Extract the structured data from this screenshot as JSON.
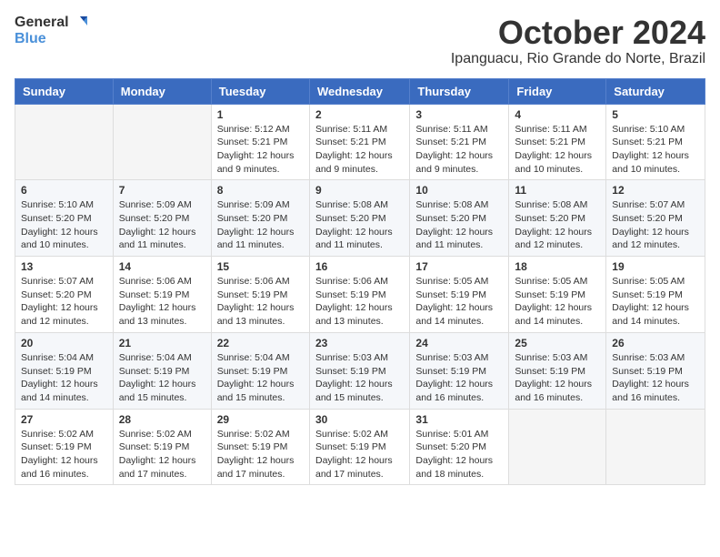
{
  "header": {
    "logo_general": "General",
    "logo_blue": "Blue",
    "month_title": "October 2024",
    "location": "Ipanguacu, Rio Grande do Norte, Brazil"
  },
  "columns": [
    "Sunday",
    "Monday",
    "Tuesday",
    "Wednesday",
    "Thursday",
    "Friday",
    "Saturday"
  ],
  "weeks": [
    [
      {
        "day": "",
        "sunrise": "",
        "sunset": "",
        "daylight": ""
      },
      {
        "day": "",
        "sunrise": "",
        "sunset": "",
        "daylight": ""
      },
      {
        "day": "1",
        "sunrise": "Sunrise: 5:12 AM",
        "sunset": "Sunset: 5:21 PM",
        "daylight": "Daylight: 12 hours and 9 minutes."
      },
      {
        "day": "2",
        "sunrise": "Sunrise: 5:11 AM",
        "sunset": "Sunset: 5:21 PM",
        "daylight": "Daylight: 12 hours and 9 minutes."
      },
      {
        "day": "3",
        "sunrise": "Sunrise: 5:11 AM",
        "sunset": "Sunset: 5:21 PM",
        "daylight": "Daylight: 12 hours and 9 minutes."
      },
      {
        "day": "4",
        "sunrise": "Sunrise: 5:11 AM",
        "sunset": "Sunset: 5:21 PM",
        "daylight": "Daylight: 12 hours and 10 minutes."
      },
      {
        "day": "5",
        "sunrise": "Sunrise: 5:10 AM",
        "sunset": "Sunset: 5:21 PM",
        "daylight": "Daylight: 12 hours and 10 minutes."
      }
    ],
    [
      {
        "day": "6",
        "sunrise": "Sunrise: 5:10 AM",
        "sunset": "Sunset: 5:20 PM",
        "daylight": "Daylight: 12 hours and 10 minutes."
      },
      {
        "day": "7",
        "sunrise": "Sunrise: 5:09 AM",
        "sunset": "Sunset: 5:20 PM",
        "daylight": "Daylight: 12 hours and 11 minutes."
      },
      {
        "day": "8",
        "sunrise": "Sunrise: 5:09 AM",
        "sunset": "Sunset: 5:20 PM",
        "daylight": "Daylight: 12 hours and 11 minutes."
      },
      {
        "day": "9",
        "sunrise": "Sunrise: 5:08 AM",
        "sunset": "Sunset: 5:20 PM",
        "daylight": "Daylight: 12 hours and 11 minutes."
      },
      {
        "day": "10",
        "sunrise": "Sunrise: 5:08 AM",
        "sunset": "Sunset: 5:20 PM",
        "daylight": "Daylight: 12 hours and 11 minutes."
      },
      {
        "day": "11",
        "sunrise": "Sunrise: 5:08 AM",
        "sunset": "Sunset: 5:20 PM",
        "daylight": "Daylight: 12 hours and 12 minutes."
      },
      {
        "day": "12",
        "sunrise": "Sunrise: 5:07 AM",
        "sunset": "Sunset: 5:20 PM",
        "daylight": "Daylight: 12 hours and 12 minutes."
      }
    ],
    [
      {
        "day": "13",
        "sunrise": "Sunrise: 5:07 AM",
        "sunset": "Sunset: 5:20 PM",
        "daylight": "Daylight: 12 hours and 12 minutes."
      },
      {
        "day": "14",
        "sunrise": "Sunrise: 5:06 AM",
        "sunset": "Sunset: 5:19 PM",
        "daylight": "Daylight: 12 hours and 13 minutes."
      },
      {
        "day": "15",
        "sunrise": "Sunrise: 5:06 AM",
        "sunset": "Sunset: 5:19 PM",
        "daylight": "Daylight: 12 hours and 13 minutes."
      },
      {
        "day": "16",
        "sunrise": "Sunrise: 5:06 AM",
        "sunset": "Sunset: 5:19 PM",
        "daylight": "Daylight: 12 hours and 13 minutes."
      },
      {
        "day": "17",
        "sunrise": "Sunrise: 5:05 AM",
        "sunset": "Sunset: 5:19 PM",
        "daylight": "Daylight: 12 hours and 14 minutes."
      },
      {
        "day": "18",
        "sunrise": "Sunrise: 5:05 AM",
        "sunset": "Sunset: 5:19 PM",
        "daylight": "Daylight: 12 hours and 14 minutes."
      },
      {
        "day": "19",
        "sunrise": "Sunrise: 5:05 AM",
        "sunset": "Sunset: 5:19 PM",
        "daylight": "Daylight: 12 hours and 14 minutes."
      }
    ],
    [
      {
        "day": "20",
        "sunrise": "Sunrise: 5:04 AM",
        "sunset": "Sunset: 5:19 PM",
        "daylight": "Daylight: 12 hours and 14 minutes."
      },
      {
        "day": "21",
        "sunrise": "Sunrise: 5:04 AM",
        "sunset": "Sunset: 5:19 PM",
        "daylight": "Daylight: 12 hours and 15 minutes."
      },
      {
        "day": "22",
        "sunrise": "Sunrise: 5:04 AM",
        "sunset": "Sunset: 5:19 PM",
        "daylight": "Daylight: 12 hours and 15 minutes."
      },
      {
        "day": "23",
        "sunrise": "Sunrise: 5:03 AM",
        "sunset": "Sunset: 5:19 PM",
        "daylight": "Daylight: 12 hours and 15 minutes."
      },
      {
        "day": "24",
        "sunrise": "Sunrise: 5:03 AM",
        "sunset": "Sunset: 5:19 PM",
        "daylight": "Daylight: 12 hours and 16 minutes."
      },
      {
        "day": "25",
        "sunrise": "Sunrise: 5:03 AM",
        "sunset": "Sunset: 5:19 PM",
        "daylight": "Daylight: 12 hours and 16 minutes."
      },
      {
        "day": "26",
        "sunrise": "Sunrise: 5:03 AM",
        "sunset": "Sunset: 5:19 PM",
        "daylight": "Daylight: 12 hours and 16 minutes."
      }
    ],
    [
      {
        "day": "27",
        "sunrise": "Sunrise: 5:02 AM",
        "sunset": "Sunset: 5:19 PM",
        "daylight": "Daylight: 12 hours and 16 minutes."
      },
      {
        "day": "28",
        "sunrise": "Sunrise: 5:02 AM",
        "sunset": "Sunset: 5:19 PM",
        "daylight": "Daylight: 12 hours and 17 minutes."
      },
      {
        "day": "29",
        "sunrise": "Sunrise: 5:02 AM",
        "sunset": "Sunset: 5:19 PM",
        "daylight": "Daylight: 12 hours and 17 minutes."
      },
      {
        "day": "30",
        "sunrise": "Sunrise: 5:02 AM",
        "sunset": "Sunset: 5:19 PM",
        "daylight": "Daylight: 12 hours and 17 minutes."
      },
      {
        "day": "31",
        "sunrise": "Sunrise: 5:01 AM",
        "sunset": "Sunset: 5:20 PM",
        "daylight": "Daylight: 12 hours and 18 minutes."
      },
      {
        "day": "",
        "sunrise": "",
        "sunset": "",
        "daylight": ""
      },
      {
        "day": "",
        "sunrise": "",
        "sunset": "",
        "daylight": ""
      }
    ]
  ]
}
